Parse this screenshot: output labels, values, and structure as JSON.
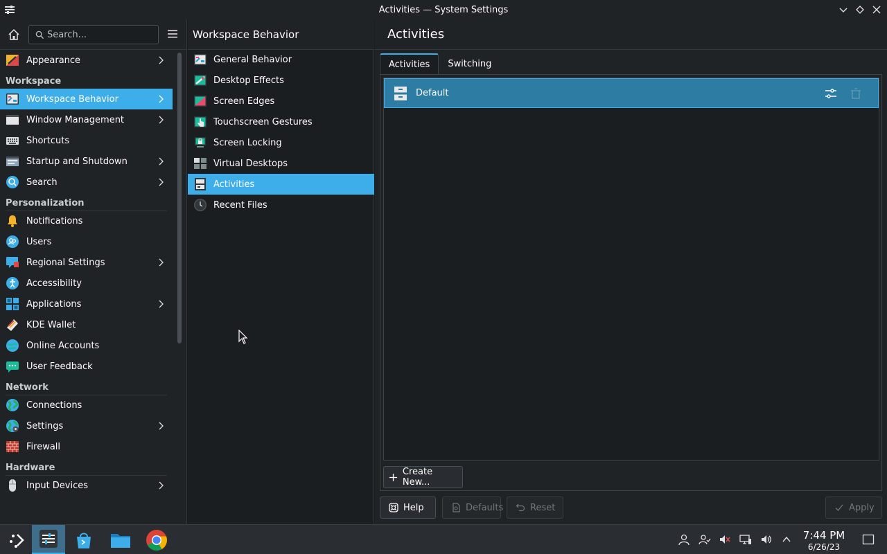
{
  "window": {
    "title": "Activities — System Settings"
  },
  "sidebar": {
    "search_placeholder": "Search...",
    "top_items": [
      {
        "label": "Appearance",
        "icon": "appearance-icon",
        "chevron": true
      }
    ],
    "sections": [
      {
        "title": "Workspace",
        "items": [
          {
            "label": "Workspace Behavior",
            "icon": "workspace-behavior-icon",
            "chevron": true,
            "active": true
          },
          {
            "label": "Window Management",
            "icon": "window-management-icon",
            "chevron": true
          },
          {
            "label": "Shortcuts",
            "icon": "keyboard-icon",
            "chevron": false
          },
          {
            "label": "Startup and Shutdown",
            "icon": "startup-icon",
            "chevron": true
          },
          {
            "label": "Search",
            "icon": "search-icon",
            "chevron": true
          }
        ]
      },
      {
        "title": "Personalization",
        "items": [
          {
            "label": "Notifications",
            "icon": "bell-icon",
            "chevron": false
          },
          {
            "label": "Users",
            "icon": "users-icon",
            "chevron": false
          },
          {
            "label": "Regional Settings",
            "icon": "regional-icon",
            "chevron": true
          },
          {
            "label": "Accessibility",
            "icon": "accessibility-icon",
            "chevron": false
          },
          {
            "label": "Applications",
            "icon": "applications-icon",
            "chevron": true
          },
          {
            "label": "KDE Wallet",
            "icon": "wallet-icon",
            "chevron": false
          },
          {
            "label": "Online Accounts",
            "icon": "online-accounts-icon",
            "chevron": false
          },
          {
            "label": "User Feedback",
            "icon": "feedback-icon",
            "chevron": false
          }
        ]
      },
      {
        "title": "Network",
        "items": [
          {
            "label": "Connections",
            "icon": "globe-icon",
            "chevron": false
          },
          {
            "label": "Settings",
            "icon": "network-settings-icon",
            "chevron": true
          },
          {
            "label": "Firewall",
            "icon": "firewall-icon",
            "chevron": false
          }
        ]
      },
      {
        "title": "Hardware",
        "items": [
          {
            "label": "Input Devices",
            "icon": "mouse-icon",
            "chevron": true
          }
        ]
      }
    ]
  },
  "midpane": {
    "title": "Workspace Behavior",
    "items": [
      {
        "label": "General Behavior",
        "icon": "general-behavior-icon"
      },
      {
        "label": "Desktop Effects",
        "icon": "desktop-effects-icon"
      },
      {
        "label": "Screen Edges",
        "icon": "screen-edges-icon"
      },
      {
        "label": "Touchscreen Gestures",
        "icon": "touch-gestures-icon"
      },
      {
        "label": "Screen Locking",
        "icon": "screen-lock-icon"
      },
      {
        "label": "Virtual Desktops",
        "icon": "virtual-desktops-icon"
      },
      {
        "label": "Activities",
        "icon": "activities-icon",
        "active": true
      },
      {
        "label": "Recent Files",
        "icon": "clock-icon"
      }
    ]
  },
  "main": {
    "title": "Activities",
    "tabs": [
      {
        "label": "Activities",
        "active": true
      },
      {
        "label": "Switching"
      }
    ],
    "activities": [
      {
        "name": "Default"
      }
    ],
    "create_label": "Create New...",
    "buttons": {
      "help": "Help",
      "defaults": "Defaults",
      "reset": "Reset",
      "apply": "Apply"
    }
  },
  "taskbar": {
    "time": "7:44 PM",
    "date": "6/26/23"
  },
  "colors": {
    "accent": "#3daee9",
    "selected_row": "#2c7ca3",
    "bg": "#1b1e21",
    "panel": "#202326"
  }
}
